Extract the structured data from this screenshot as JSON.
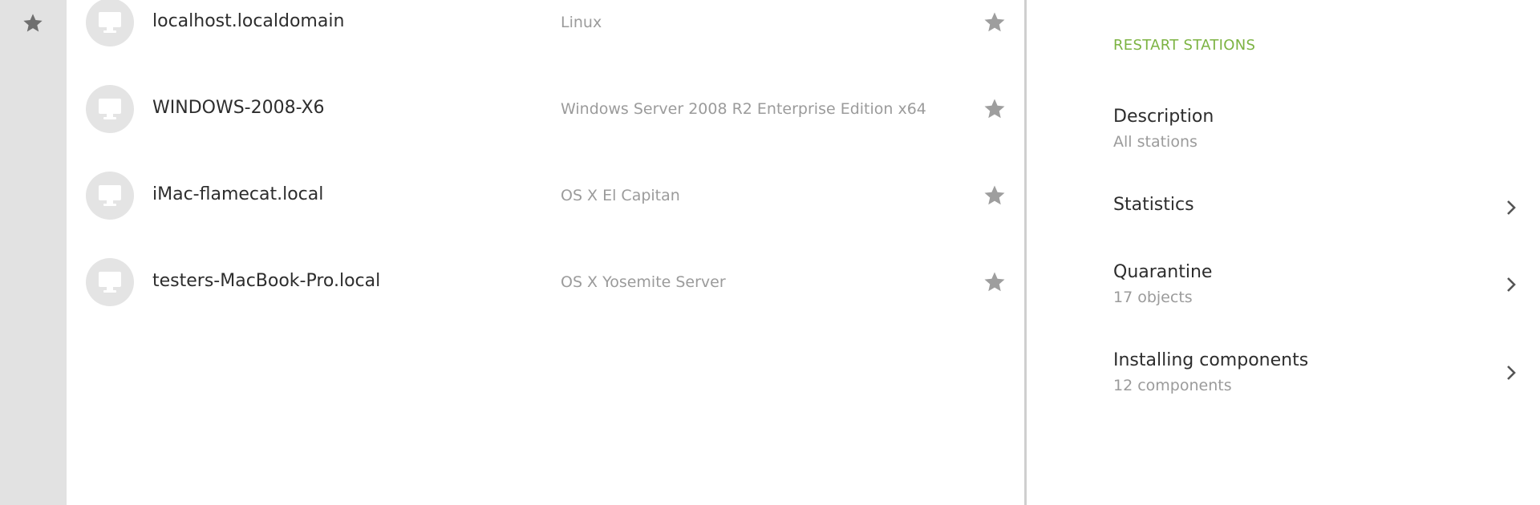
{
  "rail": {
    "icon": "star-icon"
  },
  "stations": [
    {
      "name": "localhost.localdomain",
      "os": "Linux",
      "icon": "monitor-icon"
    },
    {
      "name": "WINDOWS-2008-X6",
      "os": "Windows Server 2008 R2 Enterprise Edition x64",
      "icon": "monitor-icon"
    },
    {
      "name": "iMac-flamecat.local",
      "os": "OS X El Capitan",
      "icon": "monitor-icon"
    },
    {
      "name": "testers-MacBook-Pro.local",
      "os": "OS X Yosemite Server",
      "icon": "monitor-icon"
    }
  ],
  "details": {
    "restart_label": "RESTART STATIONS",
    "description": {
      "title": "Description",
      "subtitle": "All stations"
    },
    "statistics": {
      "title": "Statistics"
    },
    "quarantine": {
      "title": "Quarantine",
      "subtitle": "17 objects"
    },
    "installing": {
      "title": "Installing components",
      "subtitle": "12 components"
    }
  },
  "colors": {
    "accent": "#7cb342",
    "rail_bg": "#e2e2e2",
    "icon_gray": "#9e9e9e",
    "avatar_bg": "#e4e4e4",
    "text_primary": "#2d2d2d",
    "text_secondary": "#9b9b9b"
  }
}
